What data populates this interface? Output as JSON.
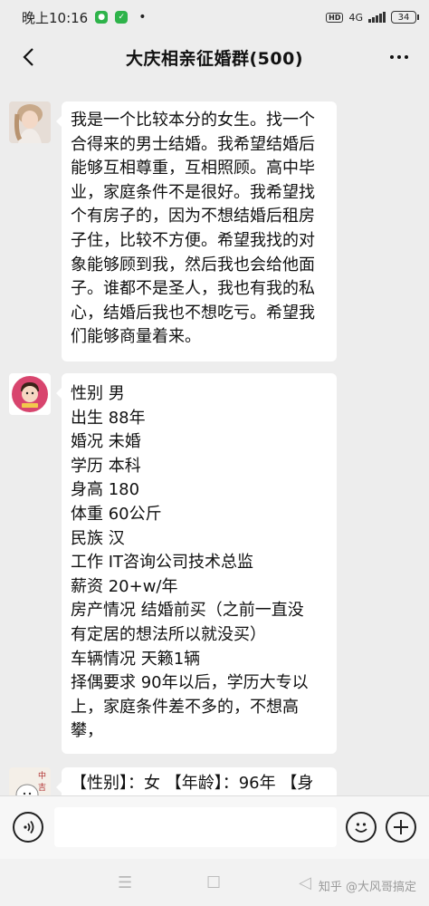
{
  "status_bar": {
    "time": "晚上10:16",
    "dot": "•",
    "network": "4G",
    "battery": "34"
  },
  "header": {
    "title": "大庆相亲征婚群(500)"
  },
  "messages": [
    {
      "lines": [
        "我是一个比较本分的女生。找一个",
        "合得来的男士结婚。我希望结婚后",
        "能够互相尊重，互相照顾。高中毕",
        "业，家庭条件不是很好。我希望找",
        "个有房子的，因为不想结婚后租房",
        "子住，比较不方便。希望我找的对",
        "象能够顾到我，然后我也会给他面",
        "子。谁都不是圣人，我也有我的私",
        "心，结婚后我也不想吃亏。希望我",
        "们能够商量着来。"
      ]
    },
    {
      "lines": [
        "性别 男",
        "出生 88年",
        "婚况 未婚",
        "学历 本科",
        "身高 180",
        "体重 60公斤",
        "民族 汉",
        "工作 IT咨询公司技术总监",
        "薪资 20+w/年",
        "房产情况 结婚前买（之前一直没",
        "有定居的想法所以就没买）",
        "车辆情况 天籁1辆",
        "择偶要求 90年以后，学历大专以",
        "上，家庭条件差不多的，不想高",
        "攀，"
      ]
    },
    {
      "lines": [
        "【性别】：女 【年龄】：96年 【身"
      ]
    }
  ],
  "avatar3_text": "中吉",
  "watermark": "知乎 @大风哥搞定",
  "colors": {
    "background": "#ededed",
    "bubble": "#ffffff",
    "wechat_green": "#2eb34a"
  },
  "icons": [
    "back-arrow-icon",
    "more-dots-icon",
    "voice-icon",
    "emoji-icon",
    "plus-icon",
    "menu-icon",
    "home-icon",
    "back-triangle-icon"
  ]
}
